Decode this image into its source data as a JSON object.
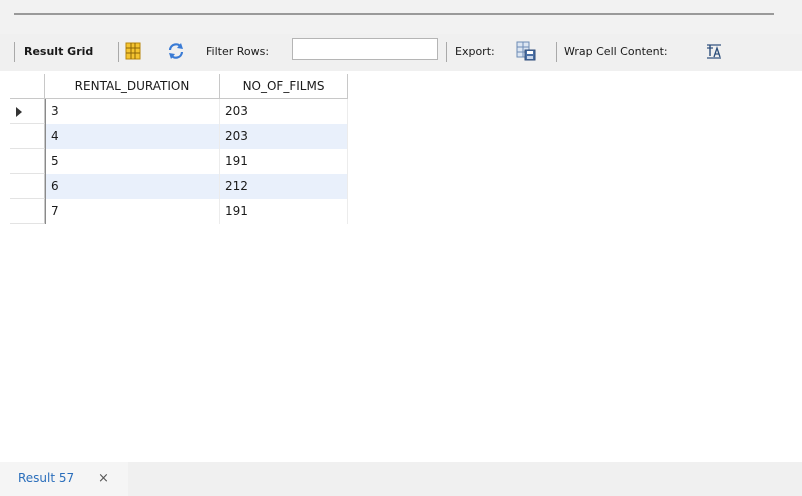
{
  "toolbar": {
    "result_grid_label": "Result Grid",
    "filter_rows_label": "Filter Rows:",
    "filter_rows_placeholder": "",
    "export_label": "Export:",
    "wrap_cell_content_label": "Wrap Cell Content:",
    "icons": [
      "grid-view-icon",
      "refresh-icon",
      "export-file-icon",
      "wrap-text-icon"
    ]
  },
  "grid": {
    "columns": [
      "RENTAL_DURATION",
      "NO_OF_FILMS"
    ],
    "rows": [
      [
        "3",
        "203"
      ],
      [
        "4",
        "203"
      ],
      [
        "5",
        "191"
      ],
      [
        "6",
        "212"
      ],
      [
        "7",
        "191"
      ]
    ],
    "selected_row_index": 0
  },
  "result_tab": {
    "label": "Result 57",
    "close_glyph": "×"
  },
  "colors": {
    "accent_link": "#2a6ebb",
    "alt_row": "#e9f0fb",
    "toolbar_bg": "#f0f0f0"
  }
}
